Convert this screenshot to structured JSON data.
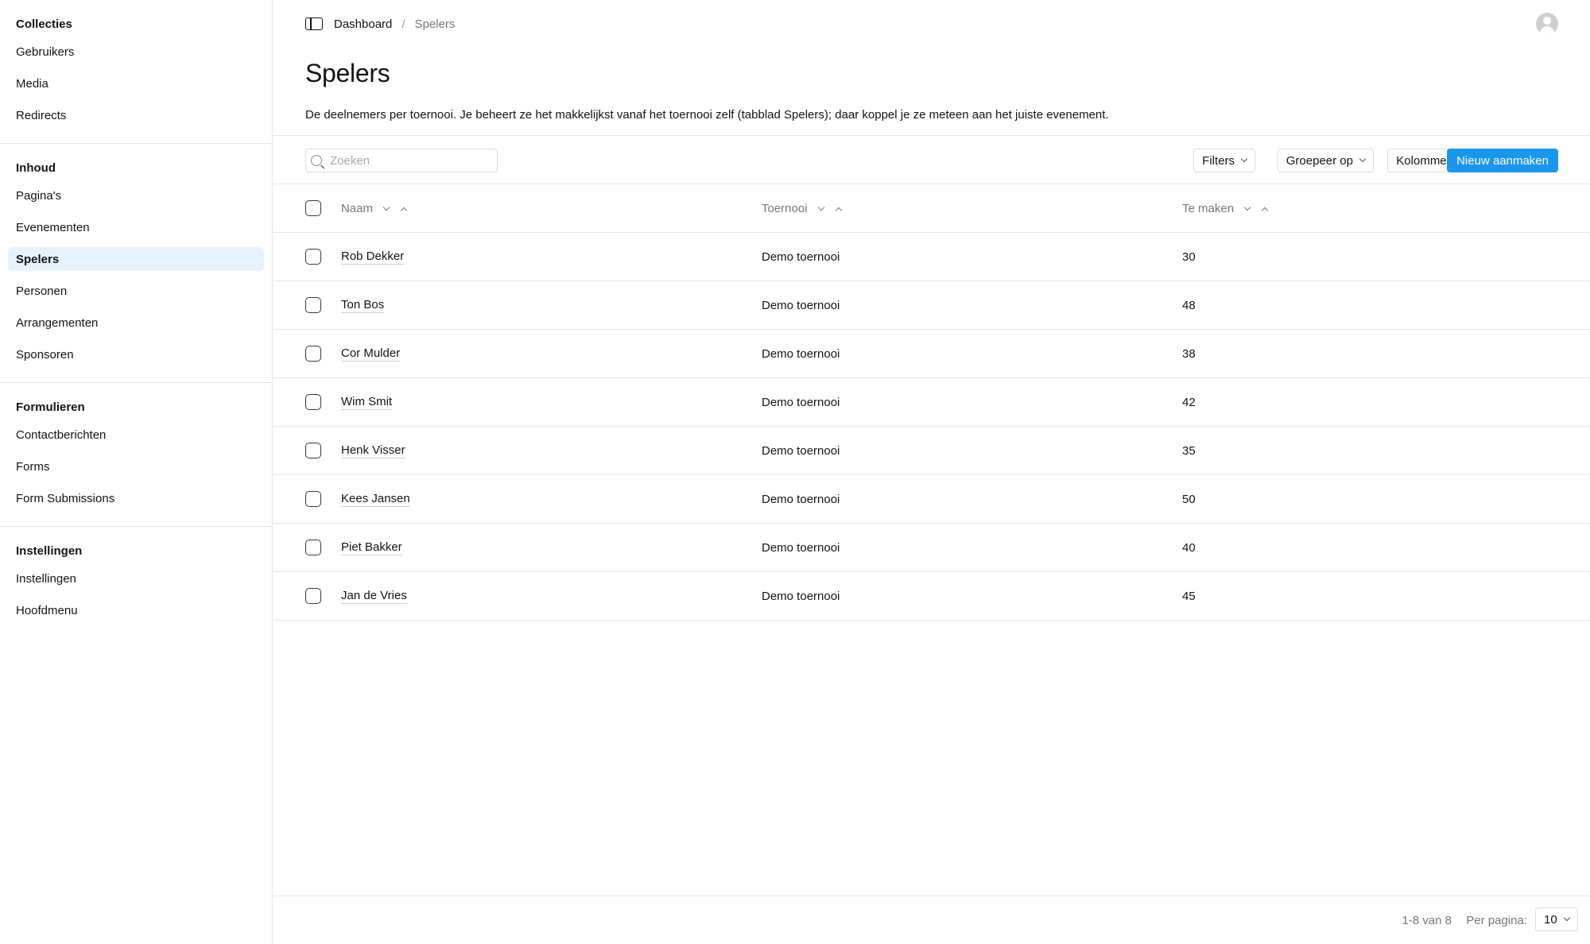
{
  "sidebar": {
    "groups": [
      {
        "title": "Collecties",
        "items": [
          "Gebruikers",
          "Media",
          "Redirects"
        ]
      },
      {
        "title": "Inhoud",
        "items": [
          "Pagina's",
          "Evenementen",
          "Spelers",
          "Personen",
          "Arrangementen",
          "Sponsoren"
        ]
      },
      {
        "title": "Formulieren",
        "items": [
          "Contactberichten",
          "Forms",
          "Form Submissions"
        ]
      },
      {
        "title": "Instellingen",
        "items": [
          "Instellingen",
          "Hoofdmenu"
        ]
      }
    ],
    "active_item": "Spelers"
  },
  "breadcrumb": {
    "root": "Dashboard",
    "separator": "/",
    "current": "Spelers"
  },
  "page": {
    "title": "Spelers",
    "description": "De deelnemers per toernooi. Je beheert ze het makkelijkst vanaf het toernooi zelf (tabblad Spelers); daar koppel je ze meteen aan het juiste evenement."
  },
  "toolbar": {
    "search_placeholder": "Zoeken",
    "filters_label": "Filters",
    "group_label": "Groepeer op",
    "columns_label": "Kolommen",
    "create_label": "Nieuw aanmaken"
  },
  "table": {
    "columns": [
      "Naam",
      "Toernooi",
      "Te maken"
    ],
    "rows": [
      {
        "naam": "Rob Dekker",
        "toernooi": "Demo toernooi",
        "te_maken": "30"
      },
      {
        "naam": "Ton Bos",
        "toernooi": "Demo toernooi",
        "te_maken": "48"
      },
      {
        "naam": "Cor Mulder",
        "toernooi": "Demo toernooi",
        "te_maken": "38"
      },
      {
        "naam": "Wim Smit",
        "toernooi": "Demo toernooi",
        "te_maken": "42"
      },
      {
        "naam": "Henk Visser",
        "toernooi": "Demo toernooi",
        "te_maken": "35"
      },
      {
        "naam": "Kees Jansen",
        "toernooi": "Demo toernooi",
        "te_maken": "50"
      },
      {
        "naam": "Piet Bakker",
        "toernooi": "Demo toernooi",
        "te_maken": "40"
      },
      {
        "naam": "Jan de Vries",
        "toernooi": "Demo toernooi",
        "te_maken": "45"
      }
    ]
  },
  "pagination": {
    "range_text": "1-8 van 8",
    "per_page_label": "Per pagina:",
    "per_page_value": "10"
  },
  "colors": {
    "primary": "#1a96ef",
    "active_nav_bg": "#e6f3fd",
    "border": "#e6e6e6"
  }
}
